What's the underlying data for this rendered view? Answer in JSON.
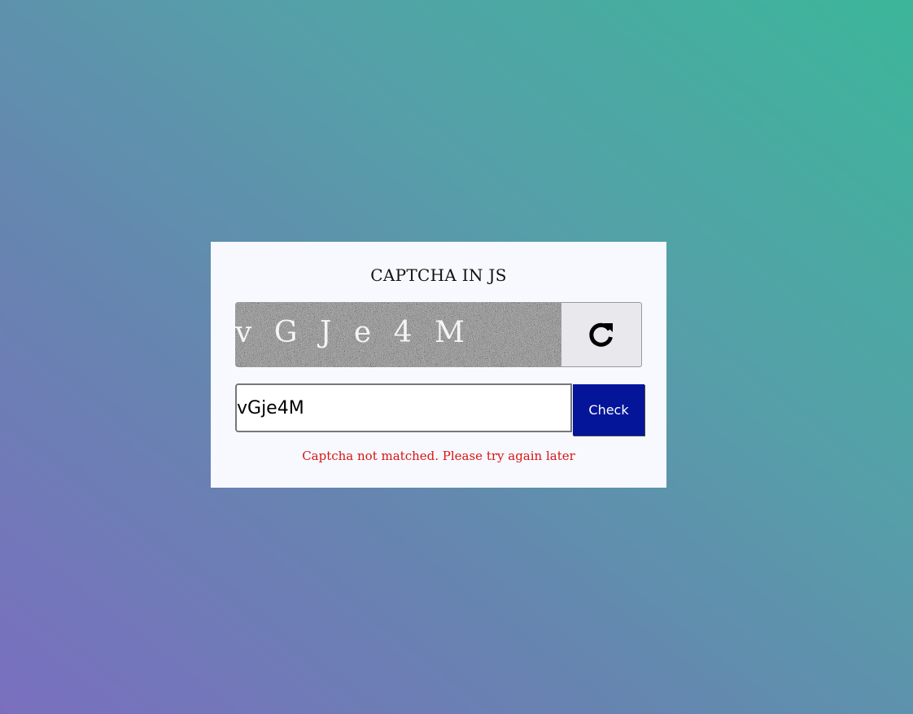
{
  "card": {
    "title": "CAPTCHA IN JS",
    "captcha": {
      "text": "v G J e 4 M",
      "refresh_icon": "refresh-icon"
    },
    "input": {
      "value": "vGje4M",
      "placeholder": ""
    },
    "check_label": "Check",
    "status_message": "Captcha not matched. Please try again later"
  },
  "colors": {
    "card_background": "#f7f9fe",
    "check_button": "#05159a",
    "error_text": "#d91414",
    "refresh_button": "#e9e8ec"
  }
}
